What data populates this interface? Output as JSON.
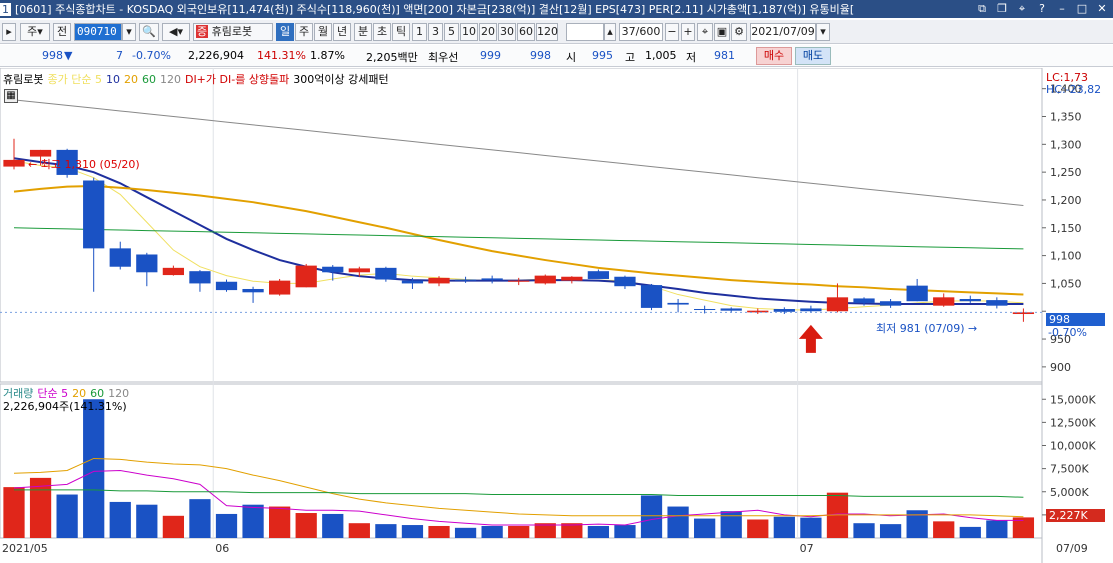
{
  "titlebar": {
    "text": "[0601] 주식종합차트 - KOSDAQ 외국인보유[11,474(천)] 주식수[118,960(천)] 액면[200] 자본금[238(억)] 결산[12월] EPS[473] PER[2.11] 시가총액[1,187(억)] 유통비율[",
    "window_no": "1"
  },
  "toolbar": {
    "market_select": "주",
    "prev_label": "전",
    "code": "090710",
    "stock_name": "휴림로봇",
    "stock_badge": "증",
    "period_buttons": [
      "일",
      "주",
      "월",
      "년",
      "분",
      "초",
      "틱"
    ],
    "active_period": "일",
    "interval_buttons": [
      "1",
      "3",
      "5",
      "10",
      "20",
      "30",
      "60",
      "120"
    ],
    "count": "37/600",
    "date": "2021/07/09"
  },
  "quote": {
    "price": "998",
    "change": "7",
    "change_pct": "-0.70%",
    "volume": "2,226,904",
    "volume_ratio": "141.31%",
    "turnover": "1.87%",
    "amount": "2,205백만",
    "best_ask_label": "최우선",
    "best_ask": "999",
    "best_bid": "998",
    "open_label": "시",
    "open": "995",
    "high_label": "고",
    "high": "1,005",
    "low_label": "저",
    "low": "981",
    "buy_label": "매수",
    "sell_label": "매도"
  },
  "price_panel": {
    "legend": [
      {
        "text": "휴림로봇",
        "color": "#000000"
      },
      {
        "text": "종가 단순 5",
        "color": "#f0e060"
      },
      {
        "text": "10",
        "color": "#1e2f9e"
      },
      {
        "text": "20",
        "color": "#e2a000"
      },
      {
        "text": "60",
        "color": "#1a9a3a"
      },
      {
        "text": "120",
        "color": "#888888"
      },
      {
        "text": "DI+가 DI-를 상향돌파",
        "color": "#d00000"
      },
      {
        "text": "300억이상 강세패턴",
        "color": "#000000"
      }
    ],
    "lc": "LC:1,73",
    "hc": "HC:-23,82",
    "high_note": "최고 1,310 (05/20)",
    "low_note": "최저 981 (07/09)",
    "last_price": "998",
    "last_change": "-0.70%"
  },
  "volume_panel": {
    "legend": [
      {
        "text": "거래량",
        "color": "#2a8a8a"
      },
      {
        "text": "단순 5",
        "color": "#cc00cc"
      },
      {
        "text": "20",
        "color": "#e2a000"
      },
      {
        "text": "60",
        "color": "#1a9a3a"
      },
      {
        "text": "120",
        "color": "#888888"
      }
    ],
    "note": "2,226,904주(141.31%)",
    "last_volume": "2,227K",
    "last_ratio": "141.31%"
  },
  "x_axis": {
    "labels": [
      {
        "text": "2021/05",
        "index": 0
      },
      {
        "text": "06",
        "index": 8
      },
      {
        "text": "07",
        "index": 30
      }
    ],
    "end_label": "07/09"
  },
  "chart_data": {
    "type": "candlestick",
    "price_axis": {
      "ticks": [
        900,
        950,
        1000,
        1050,
        1100,
        1150,
        1200,
        1250,
        1300,
        1350,
        1400
      ],
      "range": [
        880,
        1430
      ],
      "tick_labels": [
        "900",
        "950",
        "",
        "1,050",
        "1,100",
        "1,150",
        "1,200",
        "1,250",
        "1,300",
        "1,350",
        "1,400"
      ]
    },
    "volume_axis": {
      "ticks": [
        2500000,
        5000000,
        7500000,
        10000000,
        12500000,
        15000000
      ],
      "tick_labels": [
        "2,500K",
        "5,000K",
        "7,500K",
        "10,000K",
        "12,500K",
        "15,000K"
      ],
      "range": [
        0,
        16000000
      ]
    },
    "candles": [
      {
        "o": 1260,
        "h": 1310,
        "l": 1255,
        "c": 1272,
        "v": 5500000
      },
      {
        "o": 1278,
        "h": 1290,
        "l": 1262,
        "c": 1290,
        "v": 6500000
      },
      {
        "o": 1290,
        "h": 1292,
        "l": 1240,
        "c": 1245,
        "v": 4700000
      },
      {
        "o": 1235,
        "h": 1240,
        "l": 1035,
        "c": 1113,
        "v": 15000000
      },
      {
        "o": 1113,
        "h": 1125,
        "l": 1075,
        "c": 1080,
        "v": 3900000
      },
      {
        "o": 1102,
        "h": 1105,
        "l": 1045,
        "c": 1070,
        "v": 3600000
      },
      {
        "o": 1065,
        "h": 1082,
        "l": 1064,
        "c": 1078,
        "v": 2400000
      },
      {
        "o": 1072,
        "h": 1074,
        "l": 1035,
        "c": 1050,
        "v": 4200000
      },
      {
        "o": 1053,
        "h": 1057,
        "l": 1035,
        "c": 1038,
        "v": 2600000
      },
      {
        "o": 1040,
        "h": 1044,
        "l": 1015,
        "c": 1034,
        "v": 3600000
      },
      {
        "o": 1030,
        "h": 1058,
        "l": 1028,
        "c": 1055,
        "v": 3400000
      },
      {
        "o": 1043,
        "h": 1085,
        "l": 1043,
        "c": 1082,
        "v": 2700000
      },
      {
        "o": 1080,
        "h": 1083,
        "l": 1055,
        "c": 1070,
        "v": 2600000
      },
      {
        "o": 1070,
        "h": 1080,
        "l": 1062,
        "c": 1077,
        "v": 1600000
      },
      {
        "o": 1078,
        "h": 1080,
        "l": 1053,
        "c": 1057,
        "v": 1500000
      },
      {
        "o": 1055,
        "h": 1060,
        "l": 1040,
        "c": 1050,
        "v": 1400000
      },
      {
        "o": 1050,
        "h": 1063,
        "l": 1045,
        "c": 1060,
        "v": 1300000
      },
      {
        "o": 1057,
        "h": 1062,
        "l": 1051,
        "c": 1055,
        "v": 1100000
      },
      {
        "o": 1059,
        "h": 1064,
        "l": 1050,
        "c": 1056,
        "v": 1300000
      },
      {
        "o": 1053,
        "h": 1060,
        "l": 1047,
        "c": 1055,
        "v": 1300000
      },
      {
        "o": 1050,
        "h": 1066,
        "l": 1048,
        "c": 1064,
        "v": 1600000
      },
      {
        "o": 1055,
        "h": 1063,
        "l": 1050,
        "c": 1062,
        "v": 1600000
      },
      {
        "o": 1072,
        "h": 1075,
        "l": 1060,
        "c": 1058,
        "v": 1300000
      },
      {
        "o": 1062,
        "h": 1064,
        "l": 1040,
        "c": 1045,
        "v": 1400000
      },
      {
        "o": 1047,
        "h": 1049,
        "l": 1002,
        "c": 1006,
        "v": 4600000
      },
      {
        "o": 1015,
        "h": 1022,
        "l": 998,
        "c": 1012,
        "v": 3400000
      },
      {
        "o": 1004,
        "h": 1010,
        "l": 996,
        "c": 1003,
        "v": 2100000
      },
      {
        "o": 1005,
        "h": 1007,
        "l": 997,
        "c": 1001,
        "v": 2900000
      },
      {
        "o": 998,
        "h": 1005,
        "l": 995,
        "c": 1001,
        "v": 2000000
      },
      {
        "o": 1004,
        "h": 1007,
        "l": 995,
        "c": 999,
        "v": 2300000
      },
      {
        "o": 1005,
        "h": 1010,
        "l": 997,
        "c": 1000,
        "v": 2200000
      },
      {
        "o": 1000,
        "h": 1050,
        "l": 998,
        "c": 1025,
        "v": 4900000
      },
      {
        "o": 1023,
        "h": 1025,
        "l": 1010,
        "c": 1015,
        "v": 1600000
      },
      {
        "o": 1018,
        "h": 1022,
        "l": 1006,
        "c": 1010,
        "v": 1500000
      },
      {
        "o": 1046,
        "h": 1058,
        "l": 1018,
        "c": 1018,
        "v": 3000000
      },
      {
        "o": 1010,
        "h": 1032,
        "l": 1008,
        "c": 1025,
        "v": 1800000
      },
      {
        "o": 1022,
        "h": 1028,
        "l": 1015,
        "c": 1018,
        "v": 1200000
      },
      {
        "o": 1020,
        "h": 1025,
        "l": 1005,
        "c": 1010,
        "v": 1900000
      },
      {
        "o": 995,
        "h": 1005,
        "l": 981,
        "c": 998,
        "v": 2227000
      }
    ],
    "ma_lines": [
      {
        "name": "5",
        "color": "#f0e060",
        "values": [
          1270,
          1262,
          1258,
          1240,
          1210,
          1160,
          1110,
          1080,
          1064,
          1054,
          1050,
          1050,
          1058,
          1065,
          1068,
          1063,
          1060,
          1057,
          1055,
          1056,
          1058,
          1056,
          1056,
          1055,
          1045,
          1030,
          1020,
          1010,
          1005,
          1003,
          1002,
          1005,
          1008,
          1011,
          1015,
          1018,
          1019,
          1018,
          1015
        ]
      },
      {
        "name": "10",
        "color": "#1e2f9e",
        "values": [
          1275,
          1268,
          1262,
          1250,
          1230,
          1205,
          1180,
          1155,
          1130,
          1110,
          1092,
          1080,
          1070,
          1063,
          1059,
          1056,
          1055,
          1055,
          1055,
          1055,
          1056,
          1056,
          1055,
          1052,
          1046,
          1040,
          1033,
          1028,
          1023,
          1020,
          1017,
          1015,
          1014,
          1013,
          1013,
          1013,
          1013,
          1013,
          1013
        ]
      },
      {
        "name": "20",
        "color": "#e2a000",
        "values": [
          1215,
          1220,
          1224,
          1225,
          1222,
          1218,
          1213,
          1208,
          1202,
          1196,
          1188,
          1180,
          1170,
          1160,
          1150,
          1139,
          1128,
          1118,
          1108,
          1100,
          1092,
          1085,
          1078,
          1073,
          1068,
          1064,
          1060,
          1056,
          1053,
          1050,
          1048,
          1045,
          1043,
          1040,
          1038,
          1036,
          1034,
          1032,
          1030
        ]
      },
      {
        "name": "60",
        "color": "#1a9a3a",
        "values": [
          1150,
          1149,
          1148,
          1147,
          1146,
          1145,
          1144,
          1143,
          1142,
          1141,
          1140,
          1139,
          1138,
          1137,
          1136,
          1135,
          1134,
          1133,
          1132,
          1131,
          1130,
          1129,
          1128,
          1127,
          1126,
          1125,
          1124,
          1123,
          1122,
          1121,
          1120,
          1119,
          1118,
          1117,
          1116,
          1115,
          1114,
          1113,
          1112
        ]
      },
      {
        "name": "120",
        "color": "#888888",
        "values": [
          1380,
          1375,
          1370,
          1365,
          1360,
          1355,
          1350,
          1345,
          1340,
          1335,
          1330,
          1325,
          1320,
          1315,
          1310,
          1305,
          1300,
          1295,
          1290,
          1285,
          1280,
          1275,
          1270,
          1265,
          1260,
          1255,
          1250,
          1245,
          1240,
          1235,
          1230,
          1225,
          1220,
          1215,
          1210,
          1205,
          1200,
          1195,
          1190
        ]
      }
    ],
    "vol_ma_lines": [
      {
        "name": "5",
        "color": "#cc00cc",
        "values": [
          5400000,
          5600000,
          5800000,
          7200000,
          7300000,
          6800000,
          6400000,
          5800000,
          3500000,
          3300000,
          3200000,
          3000000,
          3000000,
          2900000,
          2500000,
          2100000,
          1800000,
          1600000,
          1400000,
          1400000,
          1400000,
          1400000,
          1500000,
          1400000,
          2000000,
          2400000,
          2600000,
          2800000,
          3000000,
          2500000,
          2300000,
          2600000,
          2600000,
          2400000,
          2500000,
          2600000,
          2200000,
          1900000,
          1900000
        ]
      },
      {
        "name": "20",
        "color": "#e2a000",
        "values": [
          7000000,
          7100000,
          7300000,
          8600000,
          8500000,
          8200000,
          8000000,
          7900000,
          7500000,
          6800000,
          6200000,
          5500000,
          4800000,
          4200000,
          3800000,
          3500000,
          3200000,
          3000000,
          2800000,
          2600000,
          2500000,
          2400000,
          2400000,
          2400000,
          2400000,
          2400000,
          2400000,
          2400000,
          2400000,
          2400000,
          2400000,
          2500000,
          2500000,
          2500000,
          2500000,
          2500000,
          2500000,
          2400000,
          2300000
        ]
      },
      {
        "name": "60",
        "color": "#1a9a3a",
        "values": [
          5200000,
          5200000,
          5200000,
          5200000,
          5100000,
          5100000,
          5000000,
          5000000,
          5000000,
          4900000,
          4900000,
          4900000,
          4900000,
          4800000,
          4800000,
          4800000,
          4800000,
          4800000,
          4700000,
          4700000,
          4700000,
          4700000,
          4700000,
          4700000,
          4700000,
          4600000,
          4600000,
          4600000,
          4600000,
          4600000,
          4600000,
          4600000,
          4500000,
          4500000,
          4500000,
          4500000,
          4500000,
          4500000,
          4400000
        ]
      }
    ],
    "signal_index": 30
  }
}
